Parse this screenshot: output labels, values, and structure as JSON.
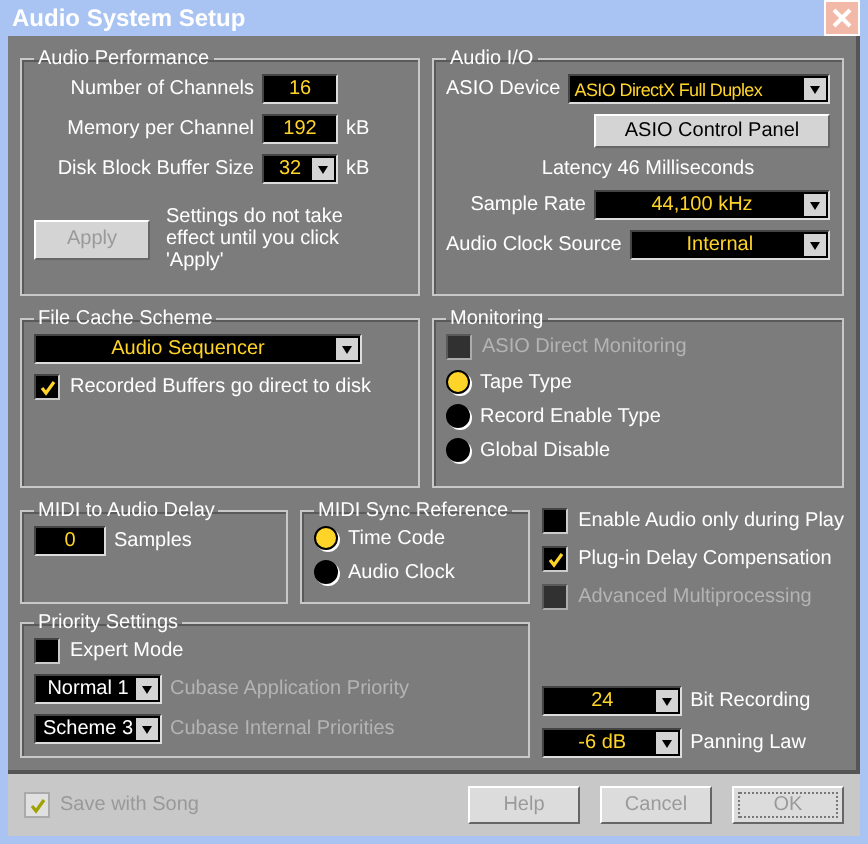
{
  "window": {
    "title": "Audio System Setup"
  },
  "audio_performance": {
    "title": "Audio Performance",
    "fields": [
      {
        "kind": "field",
        "label": "Number of Channels",
        "value": "16"
      },
      {
        "kind": "field",
        "label": "Memory per Channel",
        "value": "192",
        "unit": "kB"
      },
      {
        "kind": "select",
        "label": "Disk Block Buffer Size",
        "value": "32",
        "unit": "kB"
      }
    ],
    "apply_button": {
      "label": "Apply",
      "disabled": true
    },
    "note": "Settings do not take effect until you click 'Apply'"
  },
  "audio_io": {
    "title": "Audio I/O",
    "device_label": "ASIO Device",
    "device": "ASIO DirectX Full Duplex",
    "control_panel_button": "ASIO Control Panel",
    "latency": "Latency 46 Milliseconds",
    "selects": [
      {
        "label": "Sample Rate",
        "value": "44,100 kHz"
      },
      {
        "label": "Audio Clock Source",
        "value": "Internal"
      }
    ]
  },
  "file_cache": {
    "title": "File Cache Scheme",
    "value": "Audio Sequencer",
    "checkbox": {
      "label": "Recorded Buffers go direct to disk",
      "checked": true,
      "disabled": false
    }
  },
  "monitoring": {
    "title": "Monitoring",
    "checkbox": {
      "label": "ASIO Direct Monitoring",
      "checked": false,
      "disabled": true
    },
    "options": [
      {
        "label": "Tape Type",
        "selected": true
      },
      {
        "label": "Record Enable Type",
        "selected": false
      },
      {
        "label": "Global Disable",
        "selected": false
      }
    ]
  },
  "midi_delay": {
    "title": "MIDI to Audio Delay",
    "value": "0",
    "unit": "Samples"
  },
  "midi_sync": {
    "title": "MIDI Sync Reference",
    "options": [
      {
        "label": "Time Code",
        "selected": true
      },
      {
        "label": "Audio Clock",
        "selected": false
      }
    ]
  },
  "options": [
    {
      "label": "Enable Audio only during Play",
      "checked": false,
      "disabled": false
    },
    {
      "label": "Plug-in Delay Compensation",
      "checked": true,
      "disabled": false
    },
    {
      "label": "Advanced Multiprocessing",
      "checked": false,
      "disabled": true
    }
  ],
  "priority": {
    "title": "Priority Settings",
    "checkbox": {
      "label": "Expert Mode",
      "checked": false,
      "disabled": false
    },
    "selects": [
      {
        "value": "Normal 1",
        "label": "Cubase Application Priority"
      },
      {
        "value": "Scheme 3",
        "label": "Cubase Internal Priorities"
      }
    ]
  },
  "recording": [
    {
      "value": "24",
      "label": "Bit Recording"
    },
    {
      "value": "-6 dB",
      "label": "Panning Law"
    }
  ],
  "footer": {
    "save_checkbox": {
      "label": "Save with Song",
      "checked": true,
      "disabled": true
    },
    "buttons": [
      {
        "label": "Help",
        "disabled": true,
        "default": false
      },
      {
        "label": "Cancel",
        "disabled": true,
        "default": false
      },
      {
        "label": "OK",
        "disabled": true,
        "default": true
      }
    ]
  }
}
